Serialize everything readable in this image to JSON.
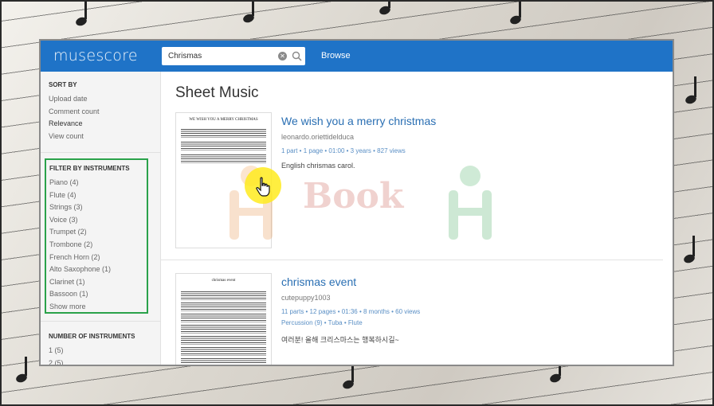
{
  "app": {
    "logo": "musescore"
  },
  "search": {
    "value": "Chrismas",
    "browse_label": "Browse"
  },
  "sidebar": {
    "sort_heading": "SORT BY",
    "sort_items": [
      {
        "label": "Upload date"
      },
      {
        "label": "Comment count"
      },
      {
        "label": "Relevance"
      },
      {
        "label": "View count"
      }
    ],
    "filter_heading": "FILTER BY INSTRUMENTS",
    "filter_items": [
      {
        "label": "Piano (4)"
      },
      {
        "label": "Flute (4)"
      },
      {
        "label": "Strings (3)"
      },
      {
        "label": "Voice (3)"
      },
      {
        "label": "Trumpet (2)"
      },
      {
        "label": "Trombone (2)"
      },
      {
        "label": "French Horn (2)"
      },
      {
        "label": "Alto Saxophone (1)"
      },
      {
        "label": "Clarinet (1)"
      },
      {
        "label": "Bassoon (1)"
      }
    ],
    "show_more": "Show more",
    "num_heading": "NUMBER OF INSTRUMENTS",
    "num_items": [
      {
        "label": "1 (5)"
      },
      {
        "label": "2 (5)"
      }
    ]
  },
  "main": {
    "title": "Sheet Music",
    "results": [
      {
        "title": "We wish you a merry christmas",
        "user": "leonardo.oriettidelduca",
        "meta": "1 part • 1 page • 01:00 • 3 years • 827 views",
        "description": "English chrismas carol.",
        "thumb_title": "WE WISH YOU A MERRY CHRISTMAS"
      },
      {
        "title": "chrismas event",
        "user": "cutepuppy1003",
        "meta": "11 parts • 12 pages • 01:36 • 8 months • 60 views",
        "tags": "Percussion (9) • Tuba • Flute",
        "description": "여러분! 올해 크리스마스는 행복하시길~",
        "thumb_title": "chrismas event"
      }
    ]
  },
  "overlay": {
    "watermark_text": "Book"
  },
  "colors": {
    "topbar": "#1f73c7",
    "filter_highlight": "#2aa24a",
    "link": "#2a6fb3"
  }
}
